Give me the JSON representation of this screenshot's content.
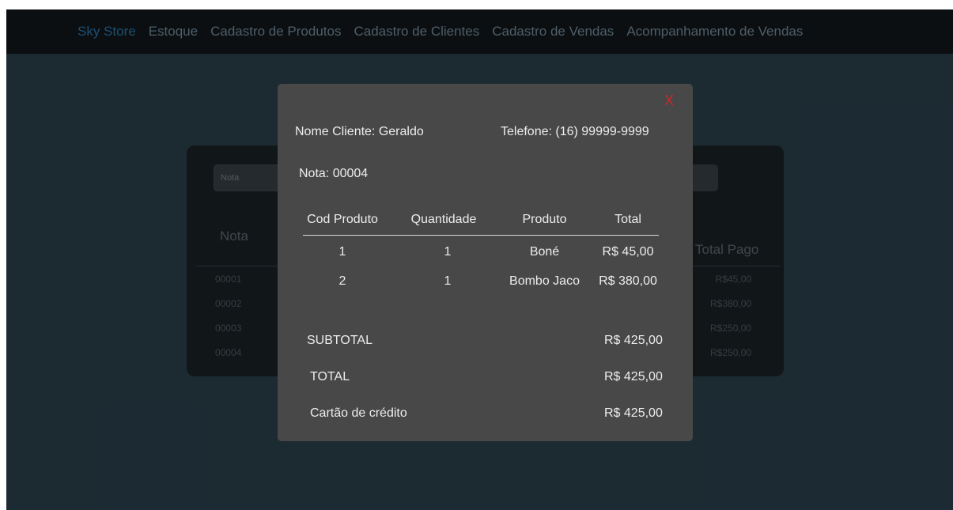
{
  "nav": {
    "brand": "Sky Store",
    "items": [
      "Estoque",
      "Cadastro de Produtos",
      "Cadastro de Clientes",
      "Cadastro de Vendas",
      "Acompanhamento de Vendas"
    ]
  },
  "background_panel": {
    "search_placeholder": "Nota",
    "columns": {
      "nota": "Nota",
      "total_pago": "Total Pago"
    },
    "rows": [
      {
        "nota": "00001",
        "total_pago": "R$45,00"
      },
      {
        "nota": "00002",
        "total_pago": "R$380,00"
      },
      {
        "nota": "00003",
        "total_pago": "R$250,00"
      },
      {
        "nota": "00004",
        "total_pago": "R$250,00"
      }
    ]
  },
  "modal": {
    "close_label": "X",
    "client_name": "Nome Cliente: Geraldo",
    "client_phone": "Telefone: (16) 99999-9999",
    "nota": "Nota: 00004",
    "table": {
      "headers": [
        "Cod Produto",
        "Quantidade",
        "Produto",
        "Total"
      ],
      "rows": [
        [
          "1",
          "1",
          "Boné",
          "R$ 45,00"
        ],
        [
          "2",
          "1",
          "Bombo Jaco",
          "R$ 380,00"
        ]
      ]
    },
    "subtotal": {
      "label": "SUBTOTAL",
      "value": "R$ 425,00"
    },
    "total": {
      "label": "TOTAL",
      "value": "R$ 425,00"
    },
    "payment": {
      "label": "Cartão de crédito",
      "value": "R$ 425,00"
    }
  },
  "colors": {
    "navbar_bg": "#0b0f12",
    "brand": "#1d4f73",
    "page_bg": "#1e2d36",
    "modal_bg": "#494848",
    "close_red": "#c8282c"
  }
}
